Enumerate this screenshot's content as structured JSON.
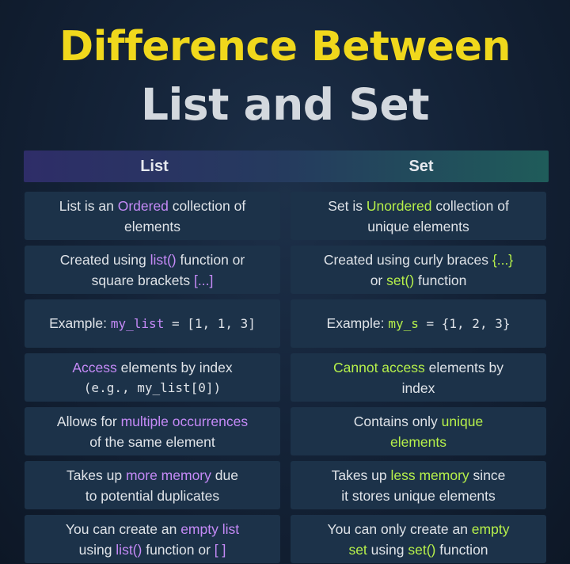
{
  "title": {
    "line1": "Difference Between",
    "line2": "List and Set"
  },
  "header": {
    "list": "List",
    "set": "Set"
  },
  "rows": [
    {
      "list": {
        "a": "List is an ",
        "hl": "Ordered",
        "b": " collection of",
        "c": "elements"
      },
      "set": {
        "a": "Set is ",
        "hl": "Unordered",
        "b": " collection of",
        "c": "unique elements"
      }
    },
    {
      "list": {
        "a": "Created using ",
        "hl": "list()",
        "b": " function or",
        "c": "square brackets ",
        "hl2": "[...]"
      },
      "set": {
        "a": "Created using curly braces ",
        "hl": "{...}",
        "c": "or ",
        "hl2": "set()",
        "d": " function"
      }
    },
    {
      "list": {
        "a": "Example: ",
        "hl": "my_list",
        "b": " = [1, 1, 3]"
      },
      "set": {
        "a": "Example: ",
        "hl": "my_s",
        "b": " = {1, 2, 3}"
      }
    },
    {
      "list": {
        "hl": "Access",
        "b": " elements by index",
        "c": "(e.g., my_list[0])"
      },
      "set": {
        "hl": "Cannot access",
        "b": " elements by",
        "c": "index"
      }
    },
    {
      "list": {
        "a": "Allows for ",
        "hl": "multiple occurrences",
        "c": "of the same element"
      },
      "set": {
        "a": "Contains only ",
        "hl": "unique",
        "hl2": "elements"
      }
    },
    {
      "list": {
        "a": "Takes up ",
        "hl": "more memory",
        "b": " due",
        "c": "to potential duplicates"
      },
      "set": {
        "a": "Takes up ",
        "hl": "less memory",
        "b": " since",
        "c": "it stores unique elements"
      }
    },
    {
      "list": {
        "a": "You can create an ",
        "hl": "empty list",
        "c": "using ",
        "hl2": "list()",
        "d": " function or ",
        "hl3": "[ ]"
      },
      "set": {
        "a": "You can only create an ",
        "hl": "empty",
        "hl2": "set",
        "c": " using ",
        "hl3": "set()",
        "d": " function"
      }
    }
  ],
  "colors": {
    "accent_list": "#c58af7",
    "accent_set": "#b6f04a",
    "title": "#f0d81c"
  }
}
